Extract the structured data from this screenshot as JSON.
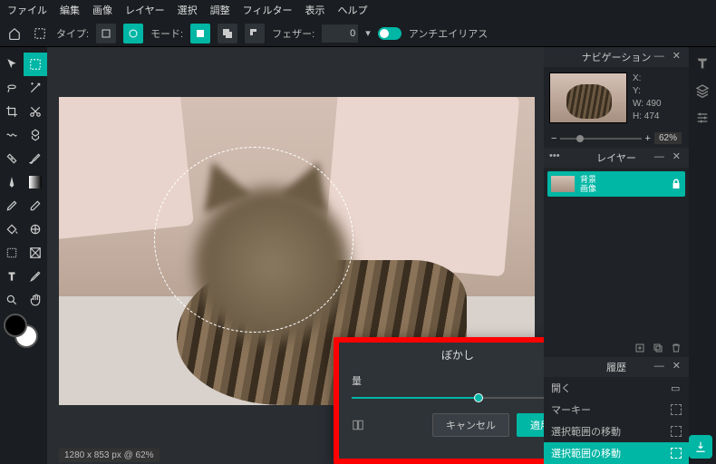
{
  "menu": {
    "items": [
      "ファイル",
      "編集",
      "画像",
      "レイヤー",
      "選択",
      "調整",
      "フィルター",
      "表示",
      "ヘルプ"
    ]
  },
  "toolbar": {
    "type_label": "タイプ:",
    "mode_label": "モード:",
    "feather_label": "フェザー:",
    "feather_value": "0",
    "antialias_label": "アンチエイリアス"
  },
  "dialog": {
    "title": "ぼかし",
    "amount_label": "量",
    "amount_value": "60",
    "cancel": "キャンセル",
    "apply": "適用"
  },
  "panels": {
    "navigator": {
      "title": "ナビゲーション",
      "x": "X:",
      "y": "Y:",
      "w": "W:",
      "h": "H:",
      "w_val": "490",
      "h_val": "474",
      "zoom": "62%"
    },
    "layers": {
      "title": "レイヤー",
      "layer0_line1": "背景",
      "layer0_line2": "画像"
    },
    "history": {
      "title": "履歴",
      "items": [
        "開く",
        "マーキー",
        "選択範囲の移動",
        "選択範囲の移動"
      ]
    }
  },
  "status": "1280 x 853 px @ 62%",
  "colors": {
    "accent": "#00b6a4"
  }
}
